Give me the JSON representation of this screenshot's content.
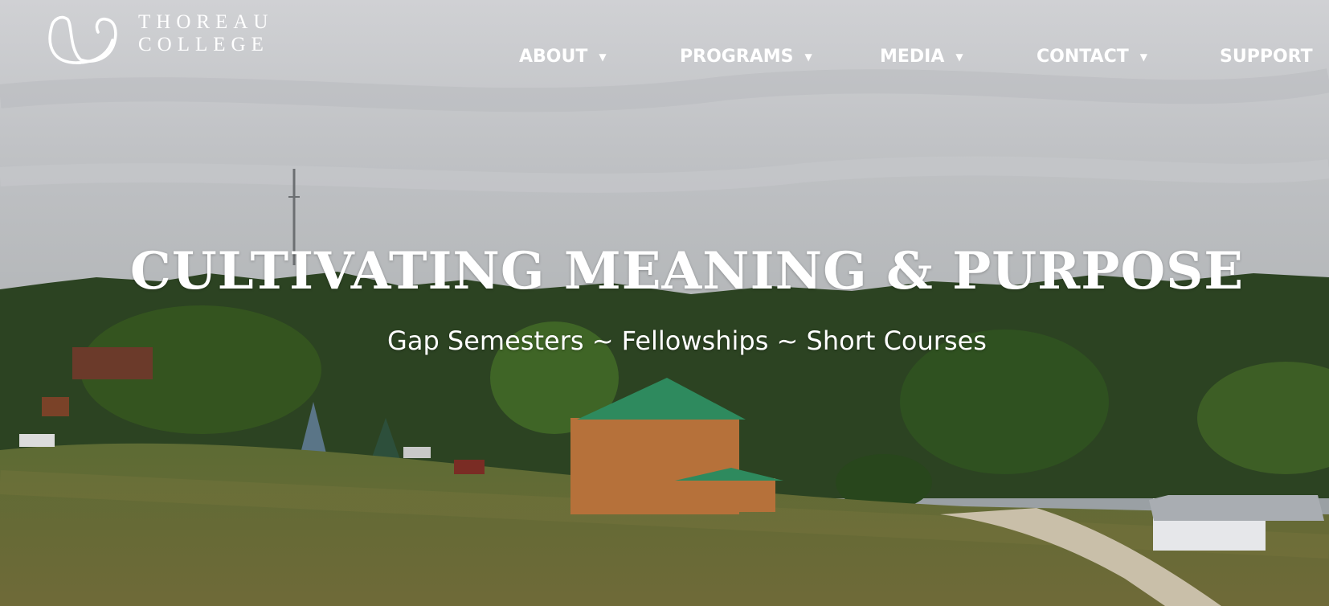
{
  "brand": {
    "line1": "THOREAU",
    "line2": "COLLEGE"
  },
  "nav": {
    "items": [
      {
        "label": "ABOUT",
        "has_dropdown": true
      },
      {
        "label": "PROGRAMS",
        "has_dropdown": true
      },
      {
        "label": "MEDIA",
        "has_dropdown": true
      },
      {
        "label": "CONTACT",
        "has_dropdown": true
      },
      {
        "label": "SUPPORT",
        "has_dropdown": false
      }
    ],
    "caret": "▼"
  },
  "hero": {
    "headline": "CULTIVATING MEANING & PURPOSE",
    "subheadline": "Gap Semesters ~ Fellowships ~ Short Courses"
  },
  "colors": {
    "sky": "#c9cacd",
    "forest": "#2f4a24",
    "meadow": "#6c7a3c",
    "roof": "#2e8a5e",
    "building": "#b6713a",
    "text": "#ffffff"
  }
}
